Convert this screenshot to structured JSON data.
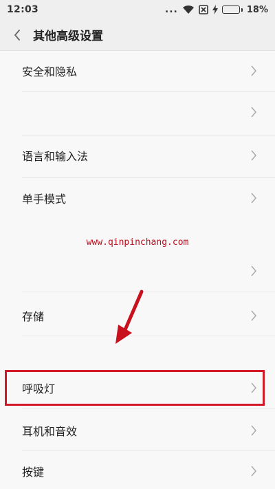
{
  "status_bar": {
    "time": "12:03",
    "dots": "...",
    "battery_percent": "18%",
    "battery_level": 0.18
  },
  "header": {
    "title": "其他高级设置"
  },
  "list": {
    "items": [
      {
        "label": "安全和隐私"
      },
      {
        "label": ""
      },
      {
        "label": "语言和输入法"
      },
      {
        "label": "单手模式"
      },
      {
        "label": ""
      },
      {
        "label": "存储"
      },
      {
        "label": ""
      },
      {
        "label": "呼吸灯"
      },
      {
        "label": "耳机和音效"
      },
      {
        "label": "按键"
      }
    ]
  },
  "watermark": {
    "text": "www.qinpinchang.com"
  },
  "colors": {
    "highlight": "#d2192a",
    "arrow": "#c8101e"
  }
}
